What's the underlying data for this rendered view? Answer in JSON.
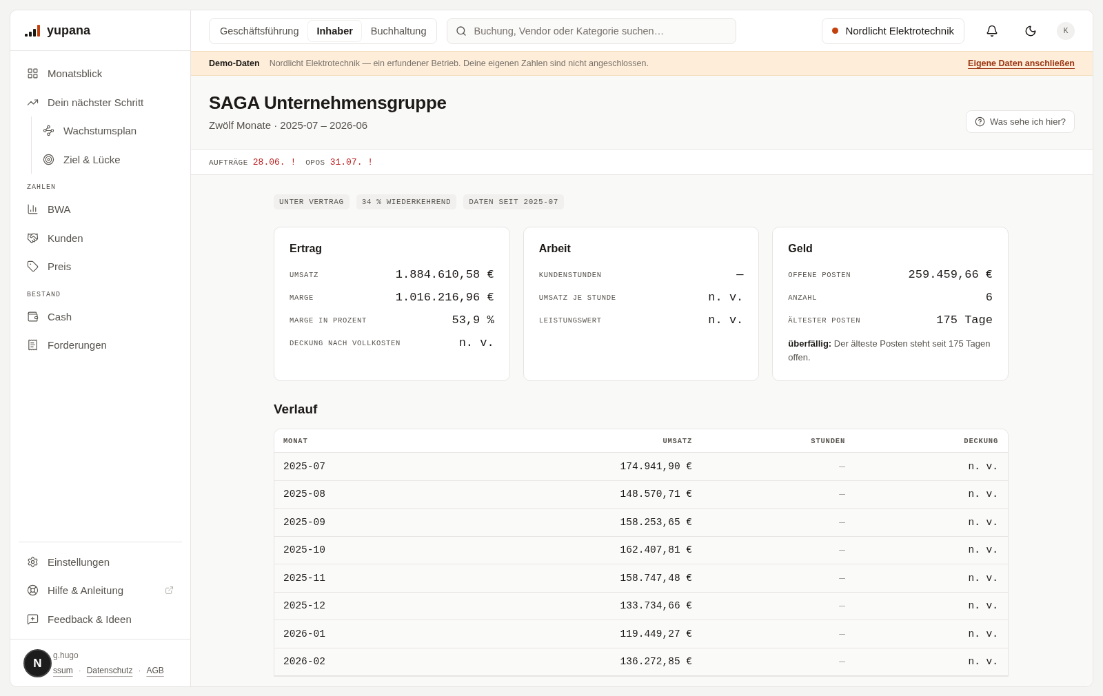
{
  "brand": {
    "name": "yupana"
  },
  "role_tabs": [
    {
      "label": "Geschäftsführung",
      "selected": false
    },
    {
      "label": "Inhaber",
      "selected": true
    },
    {
      "label": "Buchhaltung",
      "selected": false
    }
  ],
  "search": {
    "placeholder": "Buchung, Vendor oder Kategorie suchen…"
  },
  "company": {
    "name": "Nordlicht Elektrotechnik"
  },
  "avatar": "K",
  "sidebar": {
    "sections": [
      {
        "items": [
          {
            "label": "Monatsblick"
          },
          {
            "label": "Dein nächster Schritt",
            "children": [
              {
                "label": "Wachstumsplan"
              },
              {
                "label": "Ziel & Lücke"
              }
            ]
          }
        ]
      },
      {
        "heading": "ZAHLEN",
        "items": [
          {
            "label": "BWA"
          },
          {
            "label": "Kunden"
          },
          {
            "label": "Preis"
          }
        ]
      },
      {
        "heading": "BESTAND",
        "items": [
          {
            "label": "Cash"
          },
          {
            "label": "Forderungen"
          }
        ]
      }
    ],
    "footer_items": [
      {
        "label": "Einstellungen",
        "external": false
      },
      {
        "label": "Hilfe & Anleitung",
        "external": true
      },
      {
        "label": "Feedback & Ideen",
        "external": false
      }
    ],
    "credit": "g.hugo",
    "legal_links": [
      "ssum",
      "Datenschutz",
      "AGB"
    ],
    "legal_separator": "·"
  },
  "dev_badge": "N",
  "banner": {
    "label": "Demo-Daten",
    "text": "Nordlicht Elektrotechnik — ein erfundener Betrieb. Deine eigenen Zahlen sind nicht angeschlossen.",
    "link": "Eigene Daten anschließen"
  },
  "page": {
    "title": "SAGA Unternehmensgruppe",
    "subtitle": "Zwölf Monate · 2025-07 – 2026-06",
    "help_button": "Was sehe ich hier?"
  },
  "alerts": [
    {
      "label": "AUFTRÄGE",
      "value": "28.06. !"
    },
    {
      "label": "OPOS",
      "value": "31.07. !"
    }
  ],
  "tags": [
    "UNTER VERTRAG",
    "34 % WIEDERKEHREND",
    "DATEN SEIT 2025-07"
  ],
  "cards": [
    {
      "title": "Ertrag",
      "rows": [
        {
          "label": "UMSATZ",
          "value": "1.884.610,58 €"
        },
        {
          "label": "MARGE",
          "value": "1.016.216,96 €"
        },
        {
          "label": "MARGE IN PROZENT",
          "value": "53,9 %"
        },
        {
          "label": "DECKUNG NACH VOLLKOSTEN",
          "value": "n. v."
        }
      ]
    },
    {
      "title": "Arbeit",
      "rows": [
        {
          "label": "KUNDENSTUNDEN",
          "value": "—"
        },
        {
          "label": "UMSATZ JE STUNDE",
          "value": "n. v."
        },
        {
          "label": "LEISTUNGSWERT",
          "value": "n. v."
        }
      ]
    },
    {
      "title": "Geld",
      "rows": [
        {
          "label": "OFFENE POSTEN",
          "value": "259.459,66 €"
        },
        {
          "label": "ANZAHL",
          "value": "6"
        },
        {
          "label": "ÄLTESTER POSTEN",
          "value": "175 Tage"
        }
      ],
      "note": "**überfällig:** Der älteste Posten steht seit 175 Tagen offen."
    }
  ],
  "history": {
    "title": "Verlauf",
    "columns": [
      "MONAT",
      "UMSATZ",
      "STUNDEN",
      "DECKUNG"
    ],
    "rows": [
      [
        "2025-07",
        "174.941,90 €",
        "—",
        "n. v."
      ],
      [
        "2025-08",
        "148.570,71 €",
        "—",
        "n. v."
      ],
      [
        "2025-09",
        "158.253,65 €",
        "—",
        "n. v."
      ],
      [
        "2025-10",
        "162.407,81 €",
        "—",
        "n. v."
      ],
      [
        "2025-11",
        "158.747,48 €",
        "—",
        "n. v."
      ],
      [
        "2025-12",
        "133.734,66 €",
        "—",
        "n. v."
      ],
      [
        "2026-01",
        "119.449,27 €",
        "—",
        "n. v."
      ],
      [
        "2026-02",
        "136.272,85 €",
        "—",
        "n. v."
      ]
    ]
  }
}
